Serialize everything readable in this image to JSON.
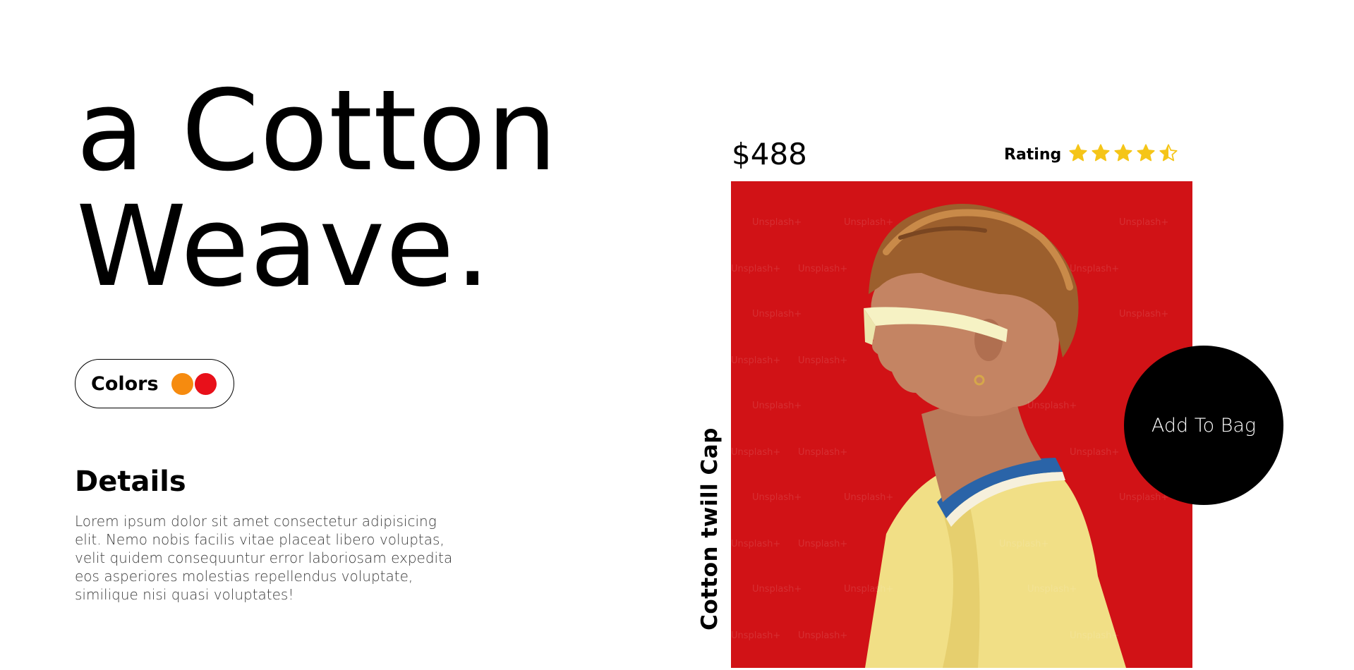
{
  "hero": {
    "line1": "a Cotton",
    "line2": "Weave."
  },
  "colors": {
    "label": "Colors",
    "swatches": [
      {
        "name": "orange",
        "color": "#F68B0F"
      },
      {
        "name": "red",
        "color": "#E8101A"
      }
    ]
  },
  "details": {
    "heading": "Details",
    "text": "Lorem ipsum dolor sit amet consectetur adipisicing elit. Nemo nobis facilis vitae placeat libero voluptas, velit quidem consequuntur error laboriosam expedita eos asperiores molestias repellendus voluptate, similique nisi quasi voluptates!"
  },
  "product": {
    "price": "$488",
    "name": "Cotton twill Cap",
    "rating_label": "Rating",
    "rating_value": 4.5,
    "rating_max": 5,
    "star_color": "#F5C518",
    "image_background": "#D11216"
  },
  "cta": {
    "label": "Add To Bag"
  }
}
